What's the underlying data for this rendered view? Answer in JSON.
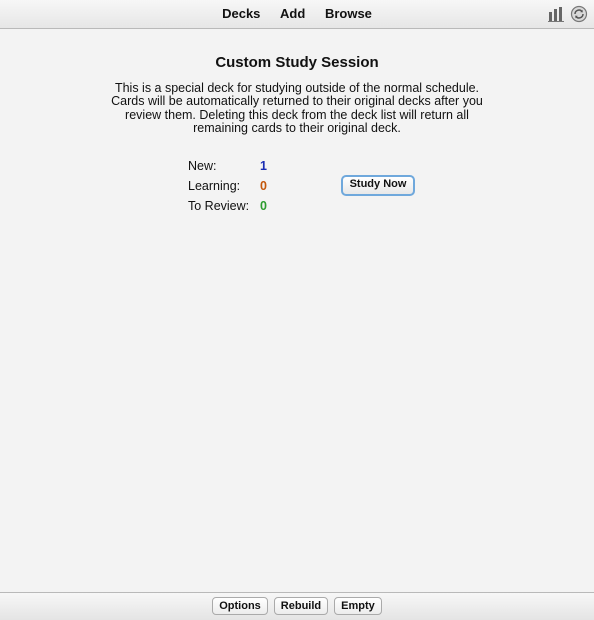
{
  "topbar": {
    "links": [
      "Decks",
      "Add",
      "Browse"
    ],
    "icons": [
      "stats-icon",
      "sync-icon"
    ]
  },
  "deck_overview": {
    "title": "Custom Study Session",
    "description": "This is a special deck for studying outside of the normal schedule. Cards will be automatically returned to their original decks after you review them. Deleting this deck from the deck list will return all remaining cards to their original deck.",
    "stats": [
      {
        "label": "New:",
        "value": "1",
        "color": "#1a2db3"
      },
      {
        "label": "Learning:",
        "value": "0",
        "color": "#c4570b"
      },
      {
        "label": "To Review:",
        "value": "0",
        "color": "#2d9c2f"
      }
    ],
    "study_button": "Study Now"
  },
  "bottombar": {
    "buttons": [
      "Options",
      "Rebuild",
      "Empty"
    ]
  }
}
